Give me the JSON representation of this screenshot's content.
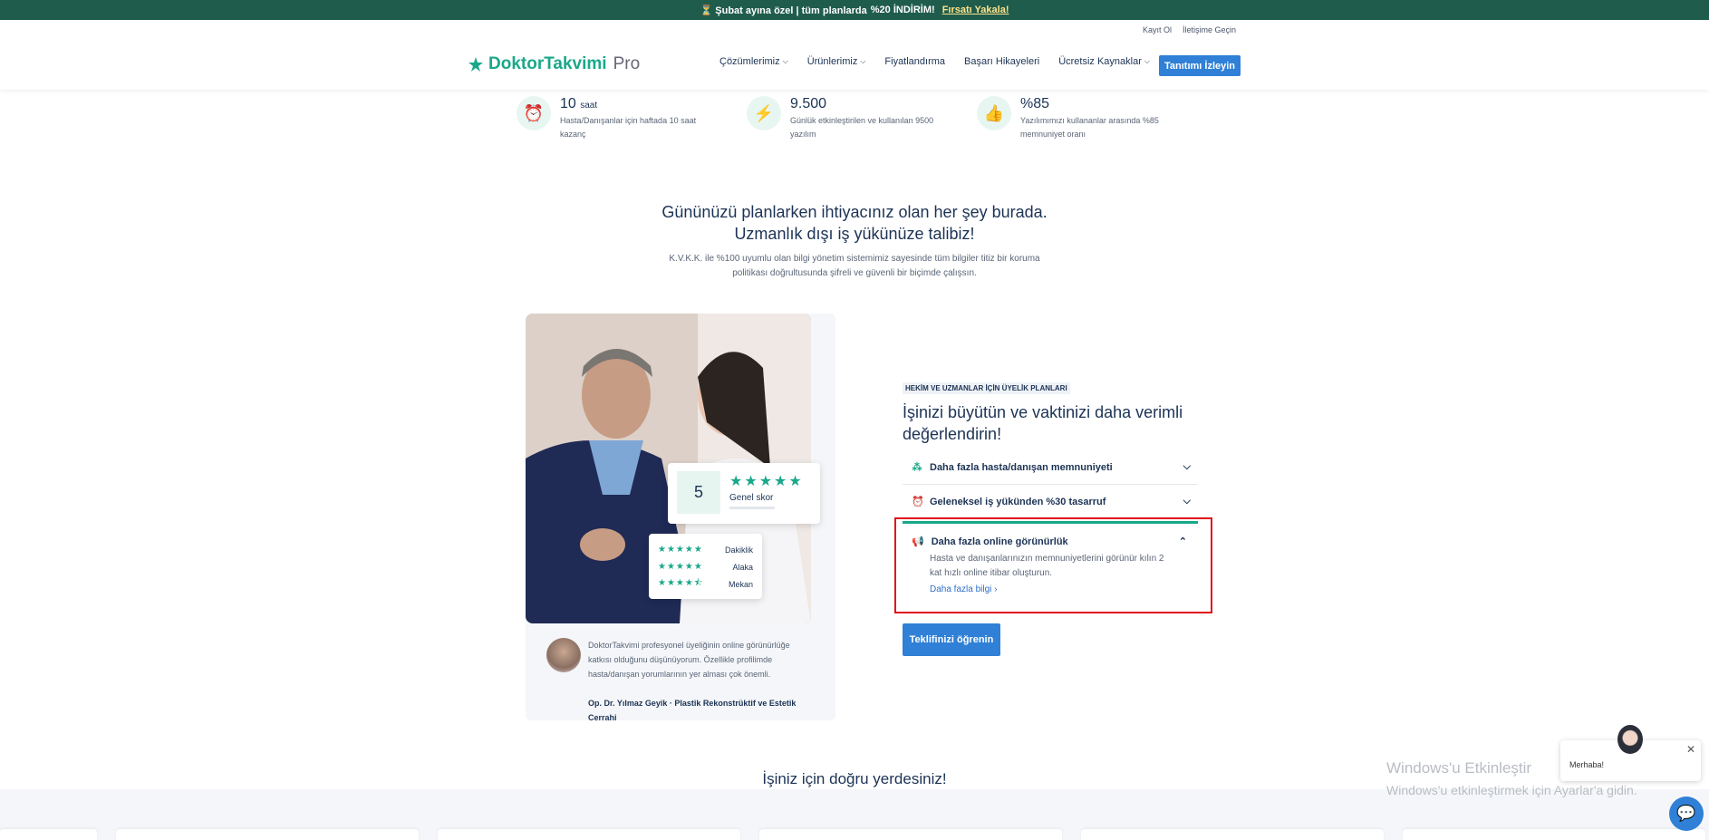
{
  "promo": {
    "text": "⏳ Şubat ayına özel | tüm planlarda",
    "highlight": "%20 İNDİRİM!",
    "link": "Fırsatı Yakala!"
  },
  "header": {
    "util_links": [
      "Kayıt Ol",
      "İletişime Geçin"
    ],
    "logo_main": "DoktorTakvimi",
    "logo_suffix": "Pro",
    "nav": [
      "Çözümlerimiz",
      "Ürünlerimiz",
      "Fiyatlandırma",
      "Başarı Hikayeleri",
      "Ücretsiz Kaynaklar"
    ],
    "cta": "Tanıtımı İzleyin"
  },
  "stats": [
    {
      "num": "10",
      "unit": "saat",
      "desc": "Hasta/Danışanlar için haftada 10 saat kazanç"
    },
    {
      "num": "9.500",
      "unit": "",
      "desc": "Günlük etkinleştirilen ve kullanılan 9500 yazılım"
    },
    {
      "num": "%85",
      "unit": "",
      "desc": "Yazılımımızı kullananlar arasında %85 memnuniyet oranı"
    }
  ],
  "section": {
    "title_line1": "Gününüzü planlarken ihtiyacınız olan her şey burada.",
    "title_line2": "Uzmanlık dışı iş yükünüze talibiz!",
    "sub_line1": "K.V.K.K. ile %100 uyumlu olan bilgi yönetim sistemimiz sayesinde tüm bilgiler titiz bir koruma",
    "sub_line2": "politikası doğrultusunda şifreli ve güvenli bir biçimde çalışsın."
  },
  "score": {
    "value": "5",
    "label": "Genel skor",
    "stars": 5
  },
  "ratings": [
    {
      "label": "Dakiklik",
      "stars": 5
    },
    {
      "label": "Alaka",
      "stars": 5
    },
    {
      "label": "Mekan",
      "stars": 4.5
    }
  ],
  "testimonial": {
    "text": "DoktorTakvimi profesyonel üyeliğinin online görünürlüğe katkısı olduğunu düşünüyorum. Özellikle profilimde hasta/danışan yorumlarının yer alması çok önemli.",
    "author": "Op. Dr. Yılmaz Geyik · Plastik Rekonstrüktif ve Estetik Cerrahi"
  },
  "plans": {
    "tag": "HEKİM VE UZMANLAR İÇİN ÜYELİK PLANLARI",
    "title": "İşinizi büyütün ve vaktinizi daha verimli değerlendirin!",
    "accordion": [
      {
        "label": "Daha fazla hasta/danışan memnuniyeti",
        "icon": "people-icon",
        "open": false
      },
      {
        "label": "Geleneksel iş yükünden %30 tasarruf",
        "icon": "alarm-icon",
        "open": false
      },
      {
        "label": "Daha fazla online görünürlük",
        "icon": "megaphone-icon",
        "open": true,
        "body": "Hasta ve danışanlarınızın memnuniyetlerini görünür kılın 2 kat hızlı online itibar oluşturun.",
        "more": "Daha fazla bilgi"
      }
    ],
    "cta": "Teklifinizi öğrenin"
  },
  "section2_title": "İşiniz için doğru yerdesiniz!",
  "windows": {
    "line1": "Windows'u Etkinleştir",
    "line2": "Windows'u etkinleştirmek için Ayarlar'a gidin."
  },
  "chat": {
    "greeting": "Merhaba!"
  },
  "colors": {
    "accent": "#1aa88a",
    "primary": "#2f80d6",
    "navy": "#1c3355",
    "promo_bg": "#1f5c4c",
    "highlight": "#e0101a"
  }
}
